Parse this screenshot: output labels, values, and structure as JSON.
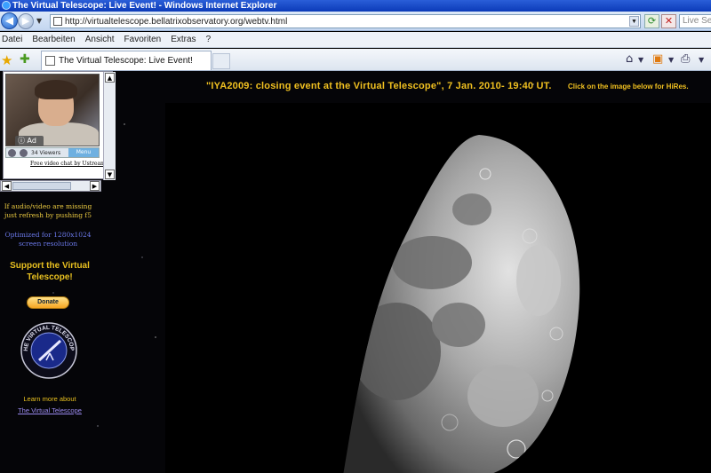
{
  "window": {
    "title": "The Virtual Telescope: Live Event! - Windows Internet Explorer"
  },
  "address": {
    "url": "http://virtualtelescope.bellatrixobservatory.org/webtv.html",
    "search_placeholder": "Live Search"
  },
  "menu": {
    "items": [
      "Datei",
      "Bearbeiten",
      "Ansicht",
      "Favoriten",
      "Extras",
      "?"
    ]
  },
  "tab": {
    "label": "The Virtual Telescope: Live Event!"
  },
  "video": {
    "ad_label": "Ad",
    "viewers": "34 Viewers",
    "menu_label": "Menu",
    "footer_link": "Free video chat by Ustream"
  },
  "sidebar": {
    "notice_refresh": "If audio/video are missing just refresh by pushing f5",
    "notice_resolution": "Optimized for 1280x1024 screen resolution",
    "support_heading": "Support the Virtual Telescope!",
    "donate_label": "Donate",
    "logo_text": "THE VIRTUAL TELESCOPE",
    "learn_more": "Learn more about",
    "learn_link": "The Virtual Telescope"
  },
  "main": {
    "event_title": "\"IYA2009: closing event at the Virtual Telescope\", 7 Jan. 2010- 19:40 UT.",
    "hires_note": "Click on the image below for HiRes."
  },
  "colors": {
    "accent_yellow": "#f0c020",
    "link_purple": "#9b8bf0",
    "notice_blue": "#6a78e8",
    "page_bg": "#050508"
  }
}
